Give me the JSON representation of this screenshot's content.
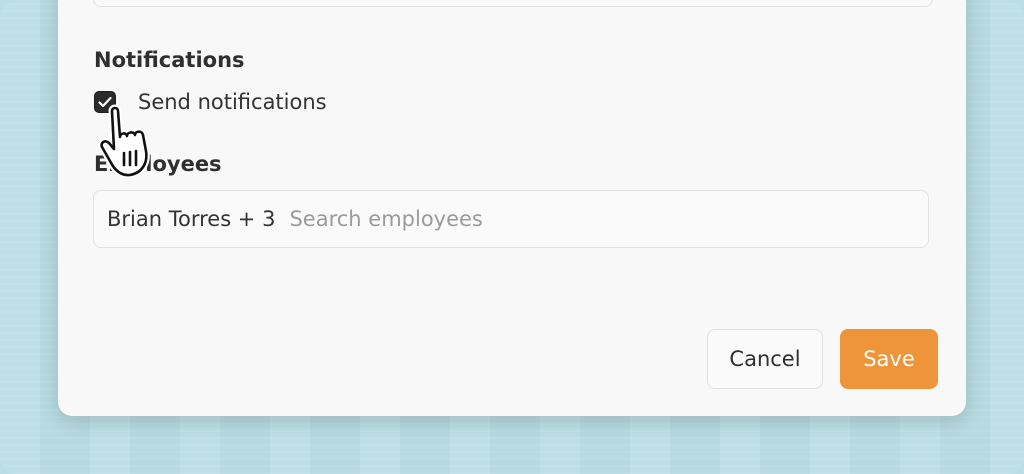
{
  "notifications": {
    "heading": "Notifications",
    "checkbox_label": "Send notifications",
    "checked": true
  },
  "employees": {
    "heading": "Employees",
    "selected": "Brian Torres + 3",
    "placeholder": "Search employees"
  },
  "actions": {
    "cancel_label": "Cancel",
    "save_label": "Save"
  },
  "colors": {
    "background": "#b9dfe5",
    "panel": "#f8f8f8",
    "save_button": "#ee943b",
    "checkbox": "#2b2b2b"
  },
  "icons": {
    "checkbox": "checkmark-icon",
    "cursor": "hand-pointer-icon"
  }
}
